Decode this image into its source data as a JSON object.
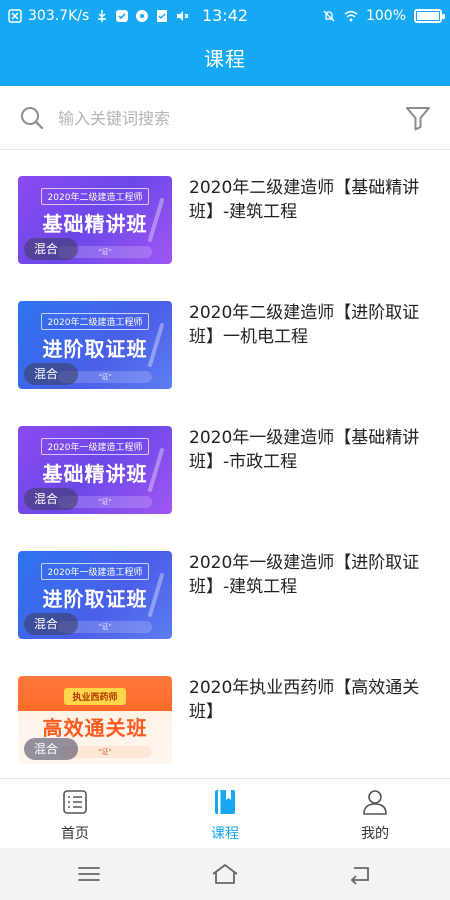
{
  "status_bar": {
    "net_speed": "303.7K/s",
    "time": "13:42",
    "battery": "100%",
    "battery_level": 1.0
  },
  "header": {
    "title": "课程"
  },
  "search": {
    "placeholder": "输入关键词搜索",
    "value": ""
  },
  "courses": [
    {
      "title": "2020年二级建造师【基础精讲班】-建筑工程",
      "thumb_top": "2020年二级建造工程师",
      "thumb_main": "基础精讲班",
      "tag": "混合",
      "thumb_sub": "\"证\"",
      "style": "purple"
    },
    {
      "title": "2020年二级建造师【进阶取证班】一机电工程",
      "thumb_top": "2020年二级建造工程师",
      "thumb_main": "进阶取证班",
      "tag": "混合",
      "thumb_sub": "\"证\"",
      "style": "blue"
    },
    {
      "title": "2020年一级建造师【基础精讲班】-市政工程",
      "thumb_top": "2020年一级建造工程师",
      "thumb_main": "基础精讲班",
      "tag": "混合",
      "thumb_sub": "\"证\"",
      "style": "purple"
    },
    {
      "title": "2020年一级建造师【进阶取证班】-建筑工程",
      "thumb_top": "2020年一级建造工程师",
      "thumb_main": "进阶取证班",
      "tag": "混合",
      "thumb_sub": "\"证\"",
      "style": "blue"
    },
    {
      "title": "2020年执业西药师【高效通关班】",
      "thumb_top": "执业西药师",
      "thumb_main": "高效通关班",
      "tag": "混合",
      "thumb_sub": "\"证\"",
      "style": "orange"
    }
  ],
  "tabs": [
    {
      "label": "首页",
      "icon": "home-list-icon",
      "active": false
    },
    {
      "label": "课程",
      "icon": "book-icon",
      "active": true
    },
    {
      "label": "我的",
      "icon": "user-icon",
      "active": false
    }
  ],
  "colors": {
    "accent": "#16a8f2",
    "text": "#222222",
    "placeholder": "#b4b4b4"
  }
}
